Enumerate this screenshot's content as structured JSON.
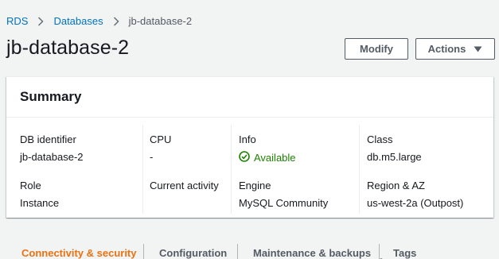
{
  "breadcrumb": {
    "items": [
      "RDS",
      "Databases"
    ],
    "current": "jb-database-2"
  },
  "page": {
    "title": "jb-database-2"
  },
  "header_actions": {
    "modify_label": "Modify",
    "actions_label": "Actions"
  },
  "summary": {
    "title": "Summary",
    "fields": {
      "db_identifier": {
        "label": "DB identifier",
        "value": "jb-database-2"
      },
      "role": {
        "label": "Role",
        "value": "Instance"
      },
      "cpu": {
        "label": "CPU",
        "value": "-"
      },
      "current_activity": {
        "label": "Current activity",
        "value": ""
      },
      "info": {
        "label": "Info",
        "value": "Available",
        "status_color": "#1d8102"
      },
      "engine": {
        "label": "Engine",
        "value": "MySQL Community"
      },
      "class": {
        "label": "Class",
        "value": "db.m5.large"
      },
      "region_az": {
        "label": "Region & AZ",
        "value": "us-west-2a (Outpost)"
      }
    }
  },
  "tabs": [
    {
      "label": "Connectivity & security",
      "active": true
    },
    {
      "label": "Configuration",
      "active": false
    },
    {
      "label": "Maintenance & backups",
      "active": false
    },
    {
      "label": "Tags",
      "active": false
    }
  ],
  "colors": {
    "link": "#0073bb",
    "active_tab": "#ec7211",
    "status_available": "#1d8102",
    "background": "#f2f3f3"
  }
}
